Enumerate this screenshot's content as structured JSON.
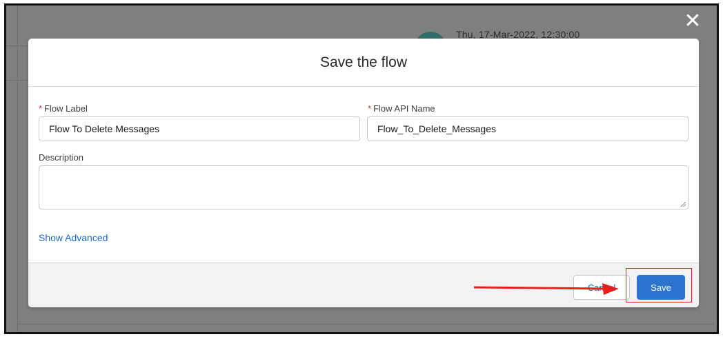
{
  "background": {
    "timestamp": "Thu, 17-Mar-2022, 12:30:00"
  },
  "dialog": {
    "title": "Save the flow",
    "close_icon": "close-icon",
    "fields": {
      "flow_label": {
        "label": "Flow Label",
        "required_marker": "*",
        "value": "Flow To Delete Messages"
      },
      "flow_api_name": {
        "label": "Flow API Name",
        "required_marker": "*",
        "value": "Flow_To_Delete_Messages"
      },
      "description": {
        "label": "Description",
        "value": ""
      }
    },
    "show_advanced": "Show Advanced",
    "footer": {
      "cancel_label": "Cancel",
      "save_label": "Save"
    }
  },
  "colors": {
    "overlay": "#7f7f7f",
    "save_button": "#2d74d0",
    "link": "#1b6bd0",
    "required": "#c23934",
    "annotation": "#e8201a"
  }
}
